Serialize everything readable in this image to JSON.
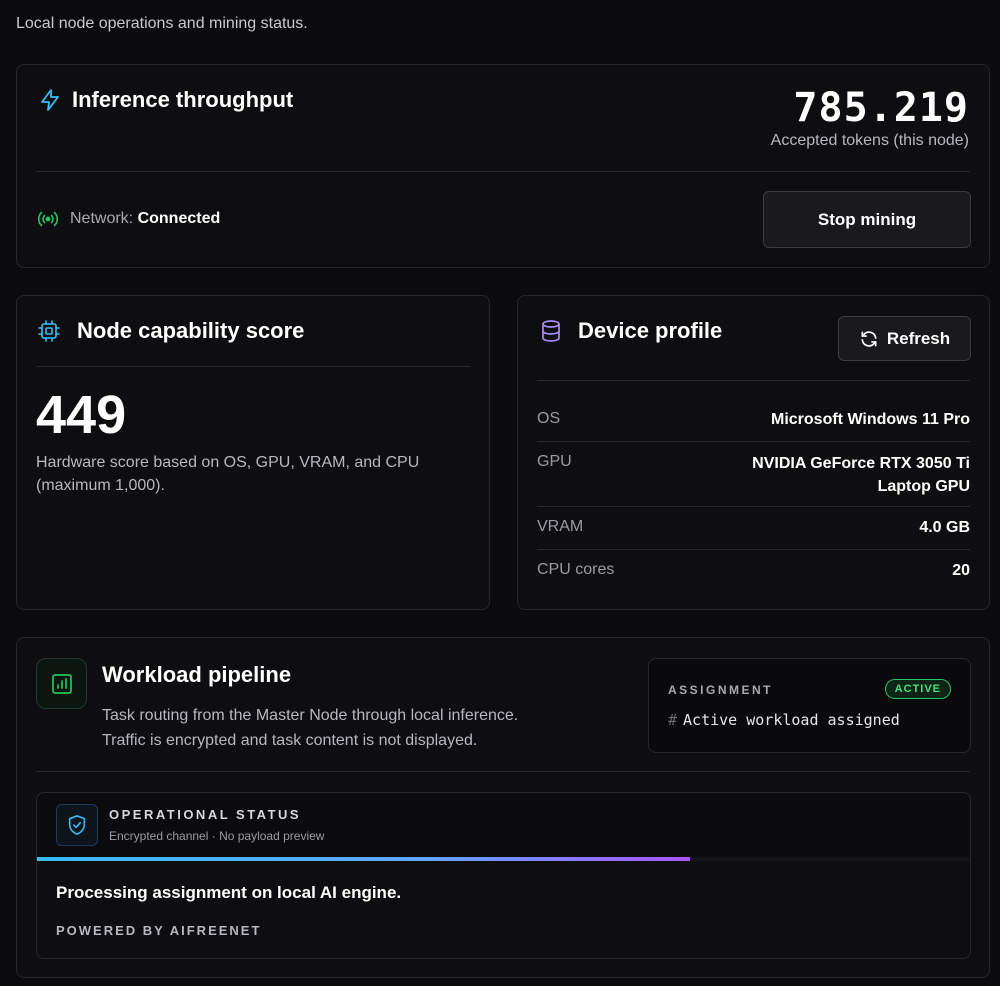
{
  "header": {
    "subtitle": "Local node operations and mining status."
  },
  "inference": {
    "title": "Inference throughput",
    "value": "785.219",
    "value_caption": "Accepted tokens (this node)",
    "network_prefix": "Network:",
    "network_status": "Connected",
    "stop_label": "Stop mining"
  },
  "node": {
    "title": "Node capability score",
    "score": "449",
    "description": "Hardware score based on OS, GPU, VRAM, and CPU (maximum 1,000)."
  },
  "device": {
    "title": "Device profile",
    "refresh_label": "Refresh",
    "rows": [
      {
        "label": "OS",
        "value": "Microsoft Windows 11 Pro"
      },
      {
        "label": "GPU",
        "value": "NVIDIA GeForce RTX 3050 Ti Laptop GPU"
      },
      {
        "label": "VRAM",
        "value": "4.0 GB"
      },
      {
        "label": "CPU cores",
        "value": "20"
      }
    ]
  },
  "workload": {
    "title": "Workload pipeline",
    "desc_line1": "Task routing from the Master Node through local inference.",
    "desc_line2": "Traffic is encrypted and task content is not displayed.",
    "assignment": {
      "label": "ASSIGNMENT",
      "badge": "ACTIVE",
      "hash": "#",
      "text": "Active workload assigned"
    },
    "status": {
      "title": "OPERATIONAL STATUS",
      "subtitle": "Encrypted channel · No payload preview",
      "progress_percent": 70,
      "message": "Processing assignment on local AI engine.",
      "powered_by": "POWERED BY AIFREENET"
    }
  },
  "colors": {
    "inference_icon": "#38bdf8",
    "node_icon": "#38bdf8",
    "device_icon": "#a78bfa",
    "network_icon": "#22c55e",
    "workload_icon": "#22c55e",
    "shield_icon": "#38bdf8",
    "badge": "#4ade80"
  },
  "icons": {
    "inference": "lightning-icon",
    "network": "signal-icon",
    "node": "cpu-chip-icon",
    "device": "database-icon",
    "refresh": "refresh-icon",
    "workload": "bar-chart-icon",
    "status": "shield-check-icon"
  }
}
